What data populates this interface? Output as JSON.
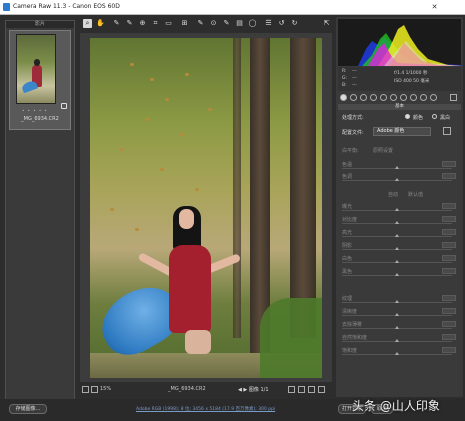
{
  "window": {
    "title": "Camera Raw 11.3  -  Canon EOS 60D"
  },
  "filmstrip": {
    "header": "影片",
    "thumb": {
      "rating": "• • • • •",
      "filename": "_MG_6934.CR2"
    }
  },
  "toolbar": {
    "tools": [
      "zoom-tool",
      "hand-tool",
      "white-balance-tool",
      "color-sampler-tool",
      "targeted-adjustment-tool",
      "crop-tool",
      "straighten-tool",
      "transform-tool",
      "spot-removal-tool",
      "red-eye-tool",
      "adjustment-brush-tool",
      "graduated-filter-tool",
      "radial-filter-tool",
      "preferences-tool",
      "rotate-left-tool",
      "rotate-right-tool"
    ],
    "fullscreen_label": "⇱"
  },
  "preview": {
    "zoom": "15%",
    "filename": "_MG_6934.CR2",
    "nav_label": "图像 1/1"
  },
  "camera_info": {
    "r_label": "R:",
    "g_label": "G:",
    "b_label": "B:",
    "r_val": "---",
    "g_val": "---",
    "b_val": "---",
    "aperture_shutter": "f/1.4   1/1000 秒",
    "iso_focal": "ISO 400   50 毫米"
  },
  "panel": {
    "section": "基本",
    "process_label": "处理方式:",
    "color_label": "颜色",
    "bw_label": "黑白",
    "profile_label": "配置文件:",
    "profile_value": "Adobe 颜色",
    "wb_label": "白平衡:",
    "wb_value": "原照设置",
    "sliders_wb": [
      "色温",
      "色调"
    ],
    "auto_label": "自动",
    "default_label": "默认值",
    "sliders_tone": [
      "曝光",
      "对比度",
      "高光",
      "阴影",
      "白色",
      "黑色"
    ],
    "sliders_presence": [
      "纹理",
      "清晰度",
      "去除薄雾",
      "自然饱和度",
      "饱和度"
    ]
  },
  "bottom": {
    "save_label": "存储图像...",
    "info_text": "Adobe RGB (1998); 8 位; 3456 x 5184 (17.9 百万像素); 300 ppi",
    "open_label": "打开对象",
    "cancel_label": "取消"
  },
  "watermark": {
    "text": "头条 @山人印象"
  },
  "colors": {
    "panel_bg": "#3a3a3a",
    "app_bg": "#2d2d2d",
    "info_link": "#7a9ac8"
  }
}
